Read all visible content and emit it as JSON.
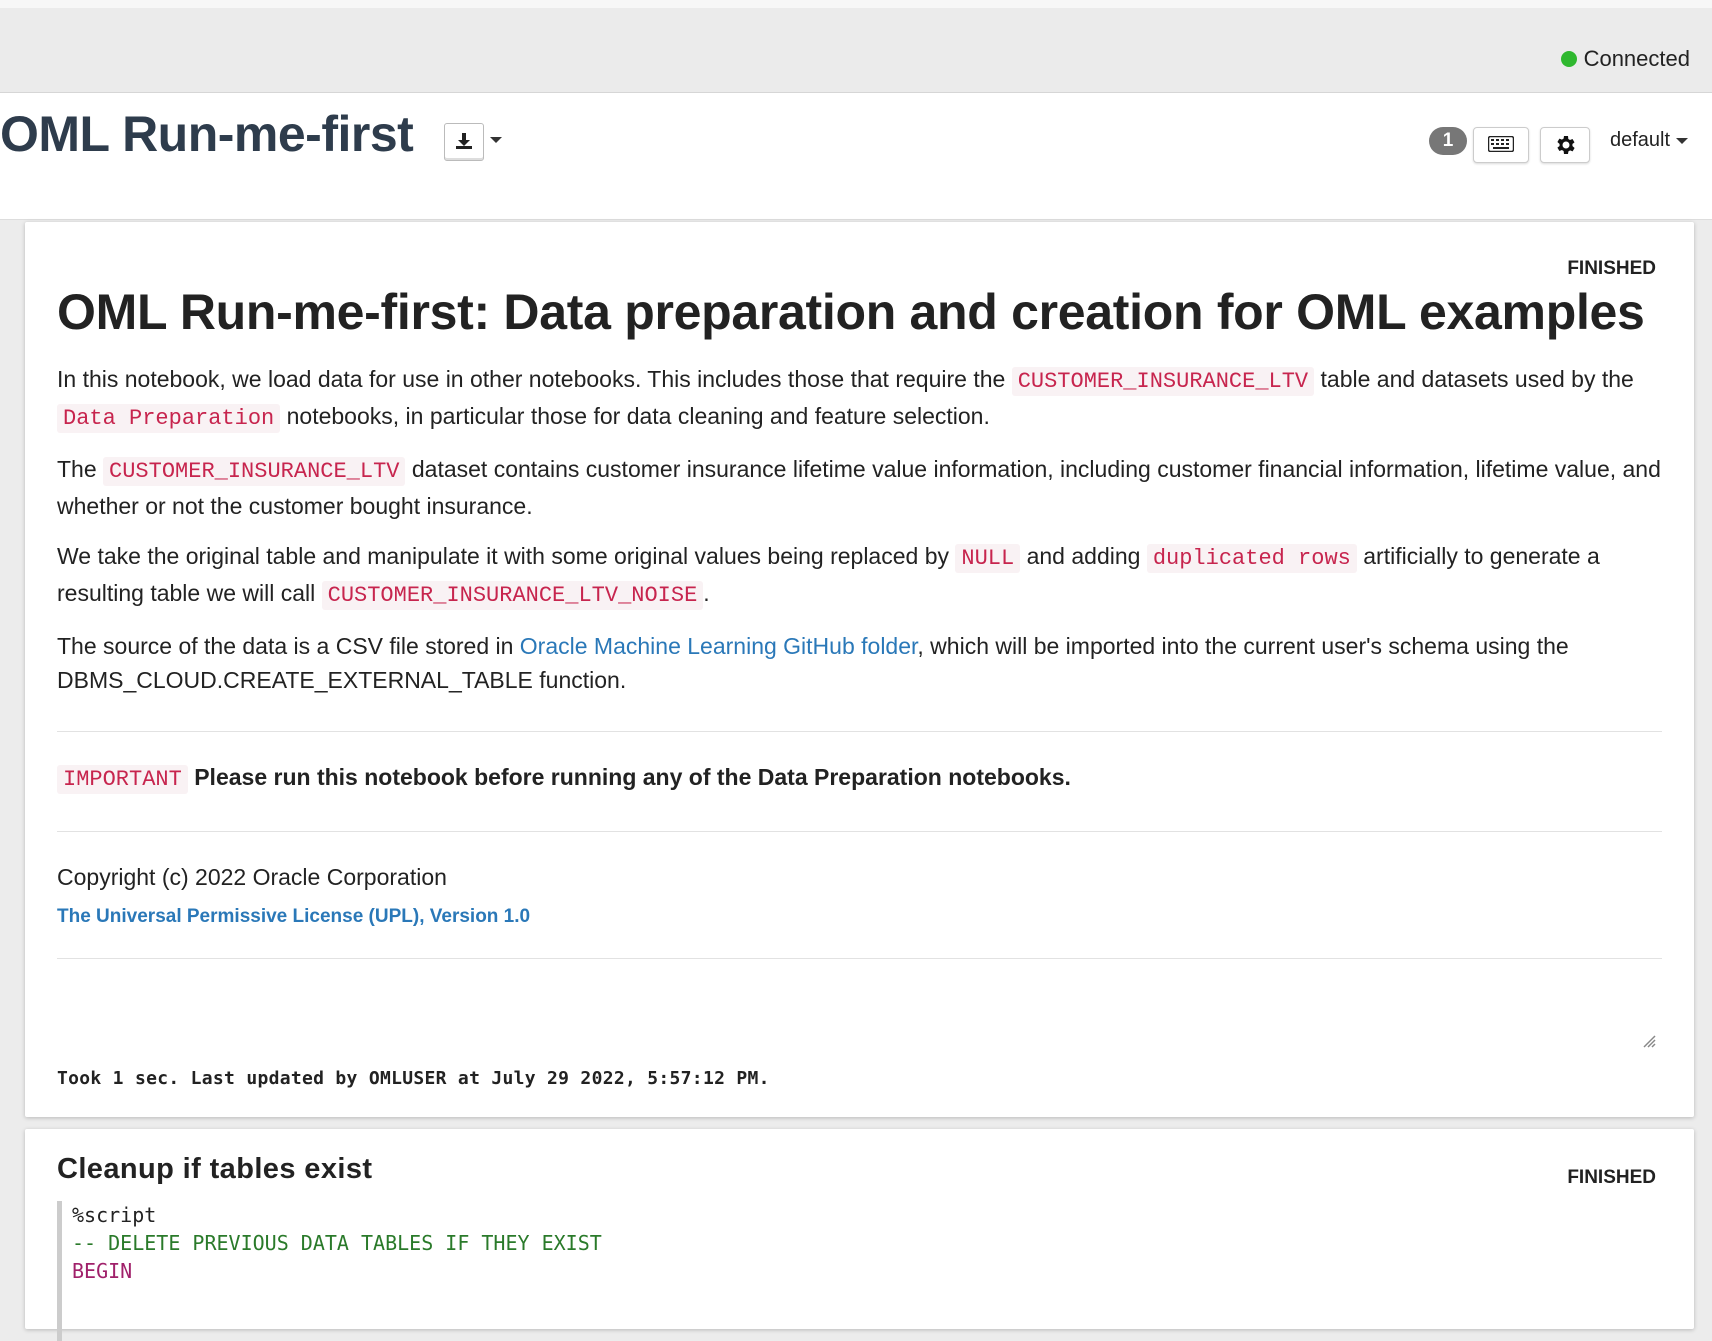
{
  "status": {
    "label": "Connected"
  },
  "header": {
    "title": "OML Run-me-first",
    "badge_count": "1",
    "interpreter": "default"
  },
  "paragraph1": {
    "state": "FINISHED",
    "title": "OML Run-me-first: Data preparation and creation for OML examples",
    "p1": {
      "t1": "In this notebook, we load data for use in other notebooks. This includes those that require the ",
      "code1": "CUSTOMER_INSURANCE_LTV",
      "t2": " table and datasets used by the ",
      "code2": "Data Preparation",
      "t3": " notebooks, in particular those for data cleaning and feature selection."
    },
    "p2": {
      "t1": "The ",
      "code1": "CUSTOMER_INSURANCE_LTV",
      "t2": " dataset contains customer insurance lifetime value information, including customer financial information, lifetime value, and whether or not the customer bought insurance."
    },
    "p3": {
      "t1": "We take the original table and manipulate it with some original values being replaced by ",
      "code1": "NULL",
      "t2": " and adding ",
      "code2": "duplicated rows",
      "t3": " artificially to generate a resulting table we will call ",
      "code3": "CUSTOMER_INSURANCE_LTV_NOISE",
      "t4": "."
    },
    "p4": {
      "t1": "The source of the data is a CSV file stored in ",
      "link": "Oracle Machine Learning GitHub folder",
      "t2": ", which will be imported into the current user's schema using the DBMS_CLOUD.CREATE_EXTERNAL_TABLE function."
    },
    "important": {
      "tag": "IMPORTANT",
      "text": " Please run this notebook before running any of the Data Preparation notebooks."
    },
    "copyright": "Copyright (c) 2022 Oracle Corporation",
    "license": "The Universal Permissive License (UPL), Version 1.0",
    "took": "Took 1 sec. Last updated by OMLUSER at July 29 2022, 5:57:12 PM."
  },
  "paragraph2": {
    "state": "FINISHED",
    "title": "Cleanup if tables exist",
    "code": [
      {
        "text": "%script",
        "style": "kw"
      },
      {
        "text": "",
        "style": "kw"
      },
      {
        "text": "-- DELETE PREVIOUS DATA TABLES IF THEY EXIST",
        "style": "cm"
      },
      {
        "text": "BEGIN",
        "style": "mg"
      }
    ]
  }
}
